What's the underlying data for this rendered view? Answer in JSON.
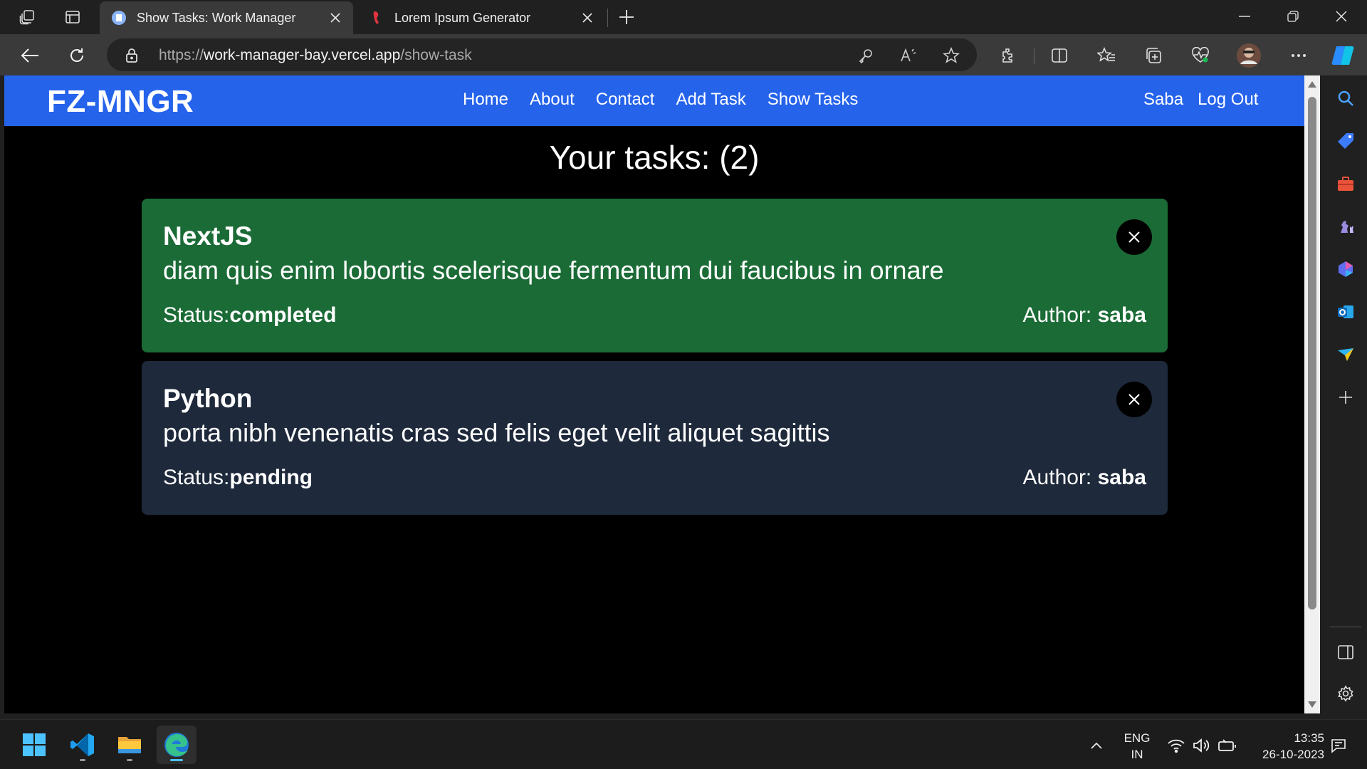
{
  "browser": {
    "tabs": [
      {
        "title": "Show Tasks: Work Manager",
        "active": true
      },
      {
        "title": "Lorem Ipsum Generator",
        "active": false
      }
    ],
    "url": {
      "scheme": "https://",
      "host": "work-manager-bay.vercel.app",
      "path": "/show-task"
    }
  },
  "app": {
    "brand": "FZ-MNGR",
    "nav": [
      "Home",
      "About",
      "Contact",
      "Add Task",
      "Show Tasks"
    ],
    "user": "Saba",
    "logout": "Log Out",
    "heading": "Your tasks: (2)",
    "tasks": [
      {
        "title": "NextJS",
        "content": "diam quis enim lobortis scelerisque fermentum dui faucibus in ornare",
        "status_label": "Status:",
        "status": "completed",
        "author_label": "Author: ",
        "author": "saba",
        "color": "#1b6b36"
      },
      {
        "title": "Python",
        "content": "porta nibh venenatis cras sed felis eget velit aliquet sagittis",
        "status_label": "Status:",
        "status": "pending",
        "author_label": "Author: ",
        "author": "saba",
        "color": "#1e293b"
      }
    ]
  },
  "taskbar": {
    "lang": "ENG",
    "region": "IN",
    "time": "13:35",
    "date": "26-10-2023"
  },
  "colors": {
    "navbar": "#2563eb",
    "completed": "#1b6b36",
    "pending": "#1e293b"
  }
}
